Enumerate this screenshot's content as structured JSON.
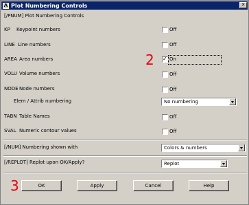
{
  "window": {
    "title": "Plot Numbering Controls",
    "icon_text": "Λ"
  },
  "header": "[/PNUM]  Plot Numbering Controls",
  "rows": [
    {
      "code": "KP",
      "label": "Keypoint numbers",
      "state": "Off",
      "checked": false
    },
    {
      "code": "LINE",
      "label": "Line numbers",
      "state": "Off",
      "checked": false
    },
    {
      "code": "AREA",
      "label": "Area numbers",
      "state": "On",
      "checked": true
    },
    {
      "code": "VOLU",
      "label": "Volume numbers",
      "state": "Off",
      "checked": false
    },
    {
      "code": "NODE",
      "label": "Node numbers",
      "state": "Off",
      "checked": false
    }
  ],
  "elem_attrib": {
    "label": "Elem / Attrib numbering",
    "value": "No numbering"
  },
  "rows2": [
    {
      "code": "TABN",
      "label": "Table Names",
      "state": "Off",
      "checked": false
    },
    {
      "code": "SVAL",
      "label": "Numeric contour values",
      "state": "Off",
      "checked": false
    }
  ],
  "num": {
    "label": "[/NUM]  Numbering shown with",
    "value": "Colors & numbers"
  },
  "replot": {
    "label": "[/REPLOT] Replot upon OK/Apply?",
    "value": "Replot"
  },
  "buttons": {
    "ok": "OK",
    "apply": "Apply",
    "cancel": "Cancel",
    "help": "Help"
  },
  "annotations": {
    "step2": "2",
    "step3": "3"
  },
  "colors": {
    "titlebar": "#0a246a",
    "dialog_bg": "#d4d0c8",
    "annotation": "#e8000f"
  }
}
